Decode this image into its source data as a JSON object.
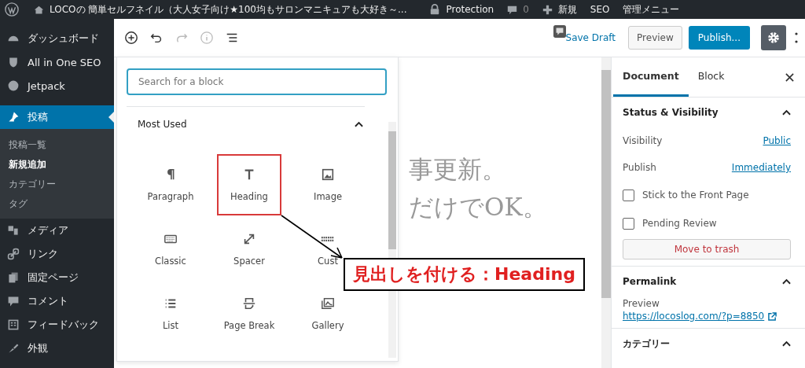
{
  "admin_bar": {
    "site_title": "LOCOの 簡単セルフネイル（大人女子向け★100均もサロンマニキュアも大好き～...",
    "items": [
      {
        "kind": "lock",
        "label": "Protection"
      },
      {
        "kind": "comments",
        "label": "0"
      },
      {
        "kind": "new",
        "label": "新規"
      },
      {
        "kind": "text",
        "label": "SEO"
      },
      {
        "kind": "text",
        "label": "管理メニュー"
      }
    ]
  },
  "sidebar": {
    "items": [
      {
        "label": "ダッシュボード",
        "selected": false
      },
      {
        "label": "All in One SEO",
        "selected": false
      },
      {
        "label": "Jetpack",
        "selected": false
      },
      {
        "label": "投稿",
        "selected": true,
        "children": [
          {
            "label": "投稿一覧",
            "selected": false
          },
          {
            "label": "新規追加",
            "selected": true
          },
          {
            "label": "カテゴリー",
            "selected": false
          },
          {
            "label": "タグ",
            "selected": false
          }
        ]
      },
      {
        "label": "メディア",
        "selected": false
      },
      {
        "label": "リンク",
        "selected": false
      },
      {
        "label": "固定ページ",
        "selected": false
      },
      {
        "label": "コメント",
        "selected": false
      },
      {
        "label": "フィードバック",
        "selected": false
      },
      {
        "label": "外観",
        "selected": false
      }
    ]
  },
  "toolbar": {
    "save_draft": "Save Draft",
    "preview": "Preview",
    "publish": "Publish..."
  },
  "inserter": {
    "search": {
      "placeholder": "Search for a block"
    },
    "section": "Most Used",
    "expanded": true,
    "blocks": [
      {
        "label": "Paragraph",
        "annotated": false
      },
      {
        "label": "Heading",
        "annotated": true
      },
      {
        "label": "Image",
        "annotated": false
      },
      {
        "label": "Classic",
        "annotated": false
      },
      {
        "label": "Spacer",
        "annotated": false
      },
      {
        "label": "Cust",
        "annotated": false
      },
      {
        "label": "List",
        "annotated": false
      },
      {
        "label": "Page Break",
        "annotated": false
      },
      {
        "label": "Gallery",
        "annotated": false
      }
    ]
  },
  "annotation": "見出しを付ける：Heading",
  "editor_text": [
    "事更新。",
    "だけでOK。"
  ],
  "settings": {
    "tabs": [
      {
        "label": "Document",
        "selected": true
      },
      {
        "label": "Block",
        "selected": false
      }
    ],
    "status": {
      "title": "Status & Visibility",
      "expanded": true,
      "rows": [
        {
          "label": "Visibility",
          "value": "Public"
        },
        {
          "label": "Publish",
          "value": "Immediately"
        }
      ],
      "checks": [
        {
          "label": "Stick to the Front Page",
          "checked": false
        },
        {
          "label": "Pending Review",
          "checked": false
        }
      ],
      "trash": "Move to trash"
    },
    "permalink": {
      "title": "Permalink",
      "expanded": true,
      "label": "Preview",
      "url": "https://locoslog.com/?p=8850"
    },
    "next_panel": {
      "title": "カテゴリー",
      "expanded": true
    }
  }
}
